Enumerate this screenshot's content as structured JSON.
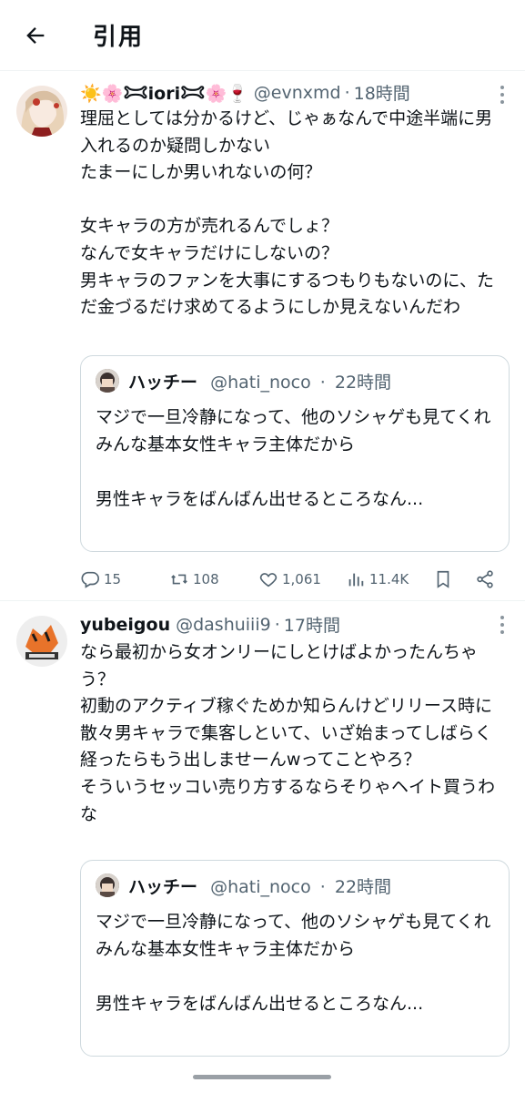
{
  "header": {
    "title": "引用"
  },
  "tweets": [
    {
      "display_name": "☀️🌸𐂯iori𐂯🌸🍷",
      "handle": "@evnxmd",
      "time": "18時間",
      "text": "理屈としては分かるけど、じゃぁなんで中途半端に男入れるのか疑問しかない\nたまーにしか男いれないの何？\n\n女キャラの方が売れるんでしょ？\nなんで女キャラだけにしないの？\n男キャラのファンを大事にするつもりもないのに、ただ金づるだけ求めてるようにしか見えないんだわ",
      "quote": {
        "name": "ハッチー",
        "handle": "@hati_noco",
        "time": "22時間",
        "text": "マジで一旦冷静になって、他のソシャゲも見てくれ\nみんな基本女性キャラ主体だから\n\n男性キャラをばんばん出せるところなん..."
      },
      "stats": {
        "replies": "15",
        "retweets": "108",
        "likes": "1,061",
        "views": "11.4K"
      }
    },
    {
      "display_name": "yubeigou",
      "handle": "@dashuiii9",
      "time": "17時間",
      "text": "なら最初から女オンリーにしとけばよかったんちゃう？\n初動のアクティブ稼ぐためか知らんけどリリース時に散々男キャラで集客しといて、いざ始まってしばらく経ったらもう出しませーんwってことやろ？\nそういうセッコい売り方するならそりゃヘイト買うわな",
      "quote": {
        "name": "ハッチー",
        "handle": "@hati_noco",
        "time": "22時間",
        "text": "マジで一旦冷静になって、他のソシャゲも見てくれ\nみんな基本女性キャラ主体だから\n\n男性キャラをばんばん出せるところなん..."
      }
    }
  ],
  "separator": "·"
}
